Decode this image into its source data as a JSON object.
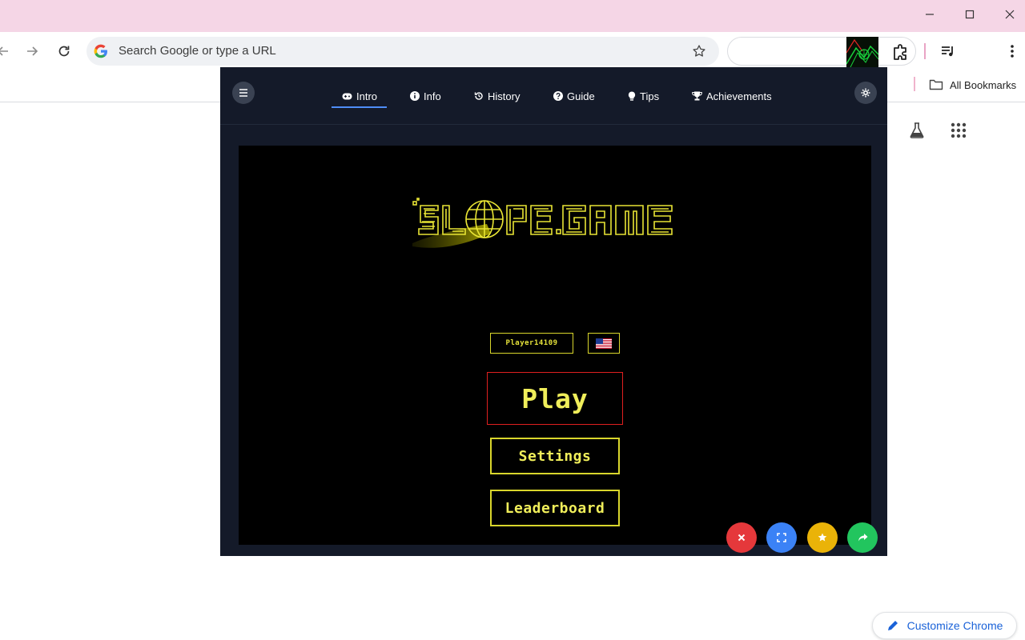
{
  "browser": {
    "omnibox": {
      "placeholder": "Search Google or type a URL"
    },
    "bookmarks": {
      "all_label": "All Bookmarks"
    },
    "customize_label": "Customize Chrome",
    "colors": {
      "titlebar": "#f5d6e6",
      "accent": "#1a62d8"
    }
  },
  "game_site": {
    "tabs": [
      {
        "label": "Intro",
        "icon": "gamepad-icon",
        "active": true
      },
      {
        "label": "Info",
        "icon": "info-icon"
      },
      {
        "label": "History",
        "icon": "history-icon"
      },
      {
        "label": "Guide",
        "icon": "question-icon"
      },
      {
        "label": "Tips",
        "icon": "lightbulb-icon"
      },
      {
        "label": "Achievements",
        "icon": "trophy-icon"
      }
    ],
    "colors": {
      "panel": "#141a29",
      "tab_active": "#4f8ef7"
    }
  },
  "game": {
    "logo_text": "SLOPE.GAME",
    "player_name": "Player14109",
    "flag": "us-flag",
    "buttons": {
      "play": "Play",
      "settings": "Settings",
      "leaderboard": "Leaderboard"
    },
    "colors": {
      "primary": "#f0ee5a",
      "play_border": "#e02020"
    }
  },
  "fabs": [
    {
      "icon": "close-icon",
      "color": "#e5383b"
    },
    {
      "icon": "fullscreen-icon",
      "color": "#3b82f6"
    },
    {
      "icon": "star-icon",
      "color": "#eab308"
    },
    {
      "icon": "share-icon",
      "color": "#22c55e"
    }
  ]
}
